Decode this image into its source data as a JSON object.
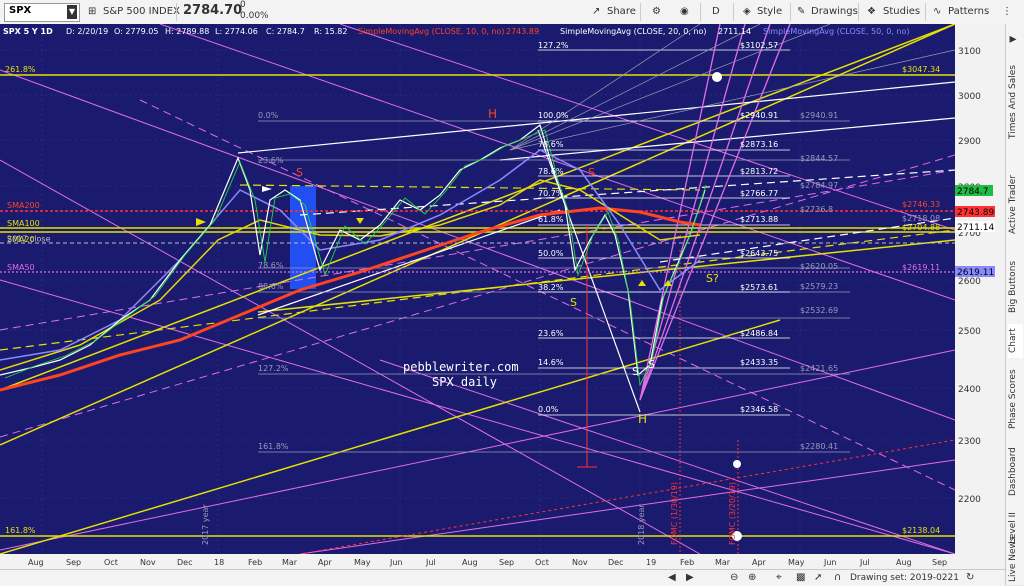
{
  "toolbar": {
    "symbol": "SPX",
    "instrument": "S&P 500 INDEX",
    "price": "2784.70",
    "change": "0",
    "change_pct": "0.00%",
    "share": "Share",
    "interval": "D",
    "style": "Style",
    "drawings": "Drawings",
    "studies": "Studies",
    "patterns": "Patterns"
  },
  "legend": {
    "line1": "SPX 5 Y 1D",
    "date": "D: 2/20/19",
    "open": "O: 2779.05",
    "high": "H: 2789.88",
    "low": "L: 2774.06",
    "close": "C: 2784.7",
    "range": "R: 15.82",
    "sma10": "SimpleMovingAvg (CLOSE, 10, 0, no)",
    "sma10_val": "2743.89",
    "sma20": "SimpleMovingAvg (CLOSE, 20, 0, no)",
    "sma20_val": "2711.14",
    "sma50": "SimpleMovingAvg (CLOSE, 50, 0, no)"
  },
  "chart_labels": {
    "watermark1": "pebblewriter.com",
    "watermark2": "SPX daily",
    "year2017": "2017 year",
    "year2018": "2018 year",
    "fomc1": "FOMC (1/30/19)",
    "fomc2": "FOMC (3/20/19)",
    "close2017": "2017 close",
    "sma200": "SMA200",
    "sma100": "SMA100",
    "sma50": "SMA50",
    "sma20": "SMA20",
    "fib_left": [
      "261.8%",
      "161.8%"
    ],
    "fib_pct": [
      "127.2%",
      "100.0%",
      "78.6%",
      "61.8%",
      "50.0%",
      "38.2%",
      "23.6%",
      "14.6%",
      "0.0%"
    ],
    "fib_vals": [
      "$3102.57",
      "$2940.91",
      "$2873.16",
      "$2813.72",
      "$2766.77",
      "$2713.88",
      "$2643.75",
      "$2573.61",
      "$2486.84",
      "$2433.35",
      "$2346.58"
    ],
    "fib_upper_pct": [
      "0.0%",
      "23.6%",
      "78.6%",
      "88.6%",
      "127.2%",
      "161.8%"
    ],
    "fib_upper_vals": [
      "$2940.91",
      "$2844.57",
      "$2784.97",
      "$2736.8",
      "$2620.05",
      "$2579.23",
      "$2532.69",
      "$2421.65",
      "$2280.41"
    ],
    "fib_horiz": [
      "$3047.34",
      "$2138.04",
      "$2746.33",
      "$2718.08",
      "$2704.88"
    ],
    "hs_labels": [
      "H",
      "S",
      "S",
      "S",
      "S",
      "S",
      "H",
      "S?"
    ],
    "fib_mid": "70.7%"
  },
  "price_axis": {
    "ticks": [
      "3100",
      "3000",
      "2900",
      "2800",
      "2700",
      "2600",
      "2500",
      "2400",
      "2300",
      "2200"
    ],
    "current": "2784.7",
    "sma10_badge": "2743.89",
    "sma20_badge": "2711.14",
    "sma50_badge": "2619.11",
    "sma50_left": "$2619.11"
  },
  "time_axis": [
    "Aug",
    "Sep",
    "Oct",
    "Nov",
    "Dec",
    "18",
    "Feb",
    "Mar",
    "Apr",
    "May",
    "Jun",
    "Jul",
    "Aug",
    "Sep",
    "Oct",
    "Nov",
    "Dec",
    "19",
    "Feb",
    "Mar",
    "Apr",
    "May",
    "Jun",
    "Jul",
    "Aug",
    "Sep"
  ],
  "side_tabs": [
    "Times And Sales",
    "Active Trader",
    "Big Buttons",
    "Chart",
    "Phase Scores",
    "Dashboard",
    "Level II",
    "Live News"
  ],
  "footer": {
    "drawing_set": "Drawing set: 2019-0221"
  },
  "chart_data": {
    "type": "line",
    "title": "SPX 5 Y 1D",
    "x_range": [
      "2017-08",
      "2019-09"
    ],
    "ylim": [
      2100,
      3150
    ],
    "series": [
      {
        "name": "SPX",
        "x": [
          "2017-08",
          "2017-10",
          "2018-01",
          "2018-02",
          "2018-04",
          "2018-06",
          "2018-08",
          "2018-09",
          "2018-10",
          "2018-11",
          "2018-12",
          "2018-12-24",
          "2019-01",
          "2019-02-20"
        ],
        "values": [
          2430,
          2550,
          2870,
          2580,
          2600,
          2750,
          2850,
          2940,
          2650,
          2720,
          2600,
          2346.58,
          2640,
          2784.7
        ]
      },
      {
        "name": "SMA200",
        "x": [
          "2017-08",
          "2018-03",
          "2018-08",
          "2019-02-20"
        ],
        "values": [
          2380,
          2610,
          2720,
          2743.89
        ]
      }
    ]
  }
}
